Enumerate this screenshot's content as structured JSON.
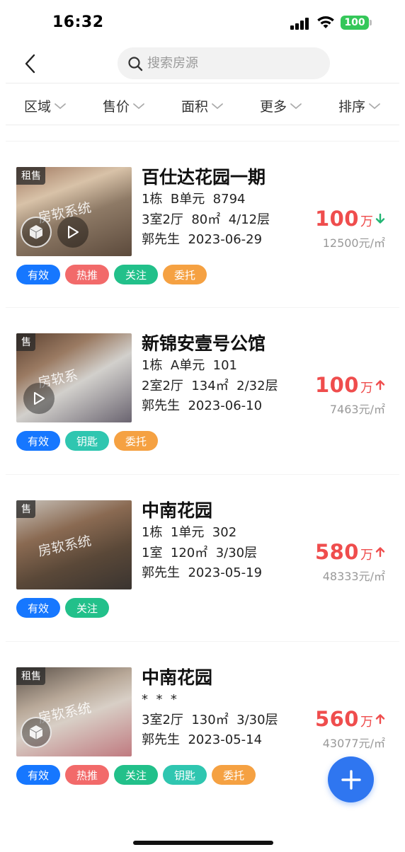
{
  "status_bar": {
    "time": "16:32",
    "battery": "100"
  },
  "search": {
    "placeholder": "搜索房源"
  },
  "filters": [
    "区域",
    "售价",
    "面积",
    "更多",
    "排序"
  ],
  "colors": {
    "price": "#ef4d4d",
    "trend_down": "#22b573",
    "trend_up": "#ef4d4d",
    "tag_valid": "#1677ff",
    "tag_hot": "#f26a6a",
    "tag_follow": "#22c08a",
    "tag_key": "#2fc6b0",
    "tag_entrust": "#f5a142",
    "fab": "#2f76f0"
  },
  "listings": [
    {
      "badge": "租售",
      "watermark": "房软系统",
      "title": "百仕达花园一期",
      "line1": "1栋  B单元  8794",
      "line2": "3室2厅  80㎡  4/12层",
      "line3": "郭先生  2023-06-29",
      "price": "100",
      "price_unit": "万",
      "trend": "down",
      "unit_price": "12500元/㎡",
      "media": [
        "vr",
        "video"
      ],
      "tags": [
        {
          "label": "有效",
          "kind": "valid"
        },
        {
          "label": "热推",
          "kind": "hot"
        },
        {
          "label": "关注",
          "kind": "follow"
        },
        {
          "label": "委托",
          "kind": "entrust"
        }
      ]
    },
    {
      "badge": "售",
      "watermark": "房软系",
      "title": "新锦安壹号公馆",
      "line1": "1栋  A单元  101",
      "line2": "2室2厅  134㎡  2/32层",
      "line3": "郭先生  2023-06-10",
      "price": "100",
      "price_unit": "万",
      "trend": "up",
      "unit_price": "7463元/㎡",
      "media": [
        "video"
      ],
      "tags": [
        {
          "label": "有效",
          "kind": "valid"
        },
        {
          "label": "钥匙",
          "kind": "key"
        },
        {
          "label": "委托",
          "kind": "entrust"
        }
      ]
    },
    {
      "badge": "售",
      "watermark": "房软系统",
      "title": "中南花园",
      "line1": "1栋  1单元  302",
      "line2": "1室  120㎡  3/30层",
      "line3": "郭先生  2023-05-19",
      "price": "580",
      "price_unit": "万",
      "trend": "up",
      "unit_price": "48333元/㎡",
      "media": [],
      "tags": [
        {
          "label": "有效",
          "kind": "valid"
        },
        {
          "label": "关注",
          "kind": "follow"
        }
      ]
    },
    {
      "badge": "租售",
      "watermark": "房软系统",
      "title": "中南花园",
      "line1": "*  *  *",
      "line2": "3室2厅  130㎡  3/30层",
      "line3": "郭先生  2023-05-14",
      "price": "560",
      "price_unit": "万",
      "trend": "up",
      "unit_price": "43077元/㎡",
      "media": [
        "vr"
      ],
      "tags": [
        {
          "label": "有效",
          "kind": "valid"
        },
        {
          "label": "热推",
          "kind": "hot"
        },
        {
          "label": "关注",
          "kind": "follow"
        },
        {
          "label": "钥匙",
          "kind": "key"
        },
        {
          "label": "委托",
          "kind": "entrust"
        }
      ]
    }
  ]
}
